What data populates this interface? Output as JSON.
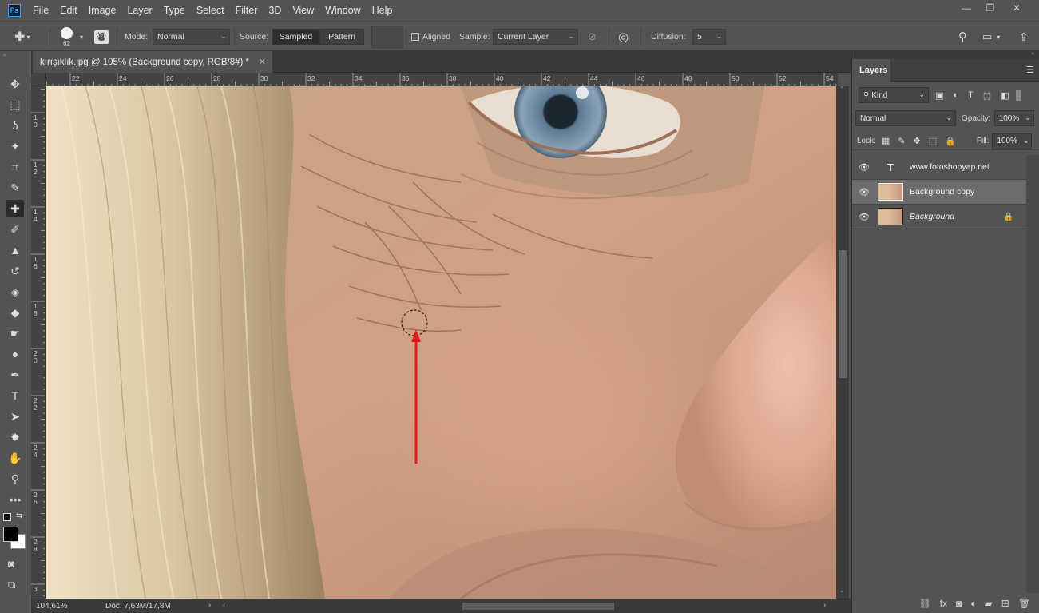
{
  "app": {
    "logo": "Ps",
    "accent": "#31a8ff"
  },
  "menu": [
    "File",
    "Edit",
    "Image",
    "Layer",
    "Type",
    "Select",
    "Filter",
    "3D",
    "View",
    "Window",
    "Help"
  ],
  "window_controls": [
    "minimize-icon",
    "restore-icon",
    "close-icon"
  ],
  "options": {
    "brush_size": "62",
    "mode_label": "Mode:",
    "mode_value": "Normal",
    "source_label": "Source:",
    "source_sampled": "Sampled",
    "source_pattern": "Pattern",
    "aligned_label": "Aligned",
    "sample_label": "Sample:",
    "sample_value": "Current Layer",
    "diffusion_label": "Diffusion:",
    "diffusion_value": "5"
  },
  "tools": [
    "move-tool-icon",
    "marquee-tool-icon",
    "lasso-tool-icon",
    "magic-wand-icon",
    "crop-tool-icon",
    "eyedropper-icon",
    "healing-brush-icon",
    "brush-tool-icon",
    "clone-stamp-icon",
    "history-brush-icon",
    "eraser-icon",
    "paint-bucket-icon",
    "smudge-icon",
    "dodge-icon",
    "pen-tool-icon",
    "type-tool-icon",
    "path-selection-icon",
    "custom-shape-icon",
    "hand-tool-icon",
    "zoom-tool-icon",
    "more-tools-icon"
  ],
  "tool_glyphs": [
    "✥",
    "⬚",
    "ʖ",
    "✦",
    "⌗",
    "✎",
    "✚",
    "✐",
    "▲",
    "↺",
    "◈",
    "◆",
    "☛",
    "●",
    "✒",
    "T",
    "➤",
    "✸",
    "✋",
    "⚲",
    "•••"
  ],
  "document": {
    "tab_title": "kırışıklık.jpg @ 105% (Background copy, RGB/8#) *",
    "ruler_h": [
      "22",
      "24",
      "26",
      "28",
      "30",
      "32",
      "34",
      "36",
      "38",
      "40",
      "42",
      "44",
      "46",
      "48",
      "50",
      "52",
      "54"
    ],
    "ruler_v": [
      "1\n0",
      "1\n2",
      "1\n4",
      "1\n6",
      "1\n8",
      "2\n0",
      "2\n2",
      "2\n4",
      "2\n6",
      "2\n8",
      "3"
    ]
  },
  "status": {
    "zoom": "104,61%",
    "doc": "Doc: 7,63M/17,8M"
  },
  "layers_panel": {
    "tab": "Layers",
    "filter_kind": "Kind",
    "blend_mode": "Normal",
    "opacity_label": "Opacity:",
    "opacity_value": "100%",
    "lock_label": "Lock:",
    "fill_label": "Fill:",
    "fill_value": "100%",
    "layers": [
      {
        "name": "www.fotoshopyap.net",
        "type": "text",
        "selected": false,
        "locked": false
      },
      {
        "name": "Background copy",
        "type": "image",
        "selected": true,
        "locked": false
      },
      {
        "name": "Background",
        "type": "image",
        "selected": false,
        "locked": true
      }
    ],
    "footer_icons": [
      "link-icon",
      "fx-icon",
      "mask-icon",
      "adjustment-icon",
      "group-folder-icon",
      "new-layer-icon",
      "trash-icon"
    ],
    "footer_glyphs": [
      "⛓",
      "fx",
      "◙",
      "◐",
      "▰",
      "⊞",
      "🗑"
    ]
  },
  "colors": {
    "arrow": "#e11b1b",
    "foreground": "#000000",
    "background": "#ffffff"
  }
}
